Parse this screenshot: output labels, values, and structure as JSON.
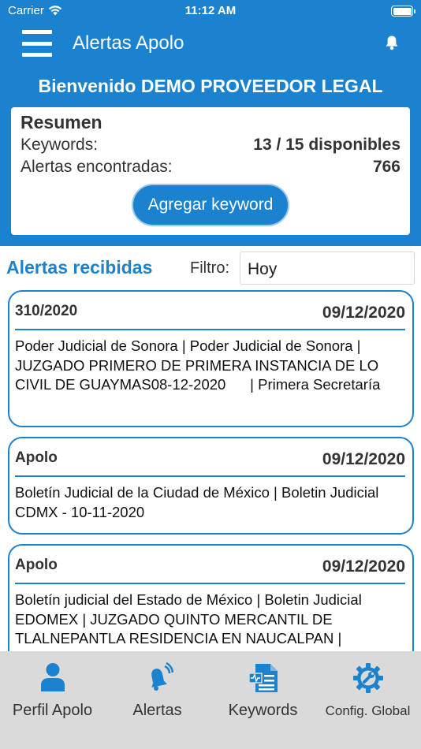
{
  "status_bar": {
    "carrier": "Carrier",
    "time": "11:12 AM"
  },
  "nav": {
    "title": "Alertas Apolo"
  },
  "welcome": {
    "title": "Bienvenido DEMO PROVEEDOR LEGAL"
  },
  "summary": {
    "heading": "Resumen",
    "keywords_label": "Keywords:",
    "keywords_value": "13 / 15 disponibles",
    "alerts_label": "Alertas encontradas:",
    "alerts_value": "766",
    "add_button": "Agregar keyword"
  },
  "alerts": {
    "heading": "Alertas recibidas",
    "filter_label": "Filtro:",
    "filter_value": "Hoy",
    "items": [
      {
        "source": "310/2020",
        "date": "09/12/2020",
        "description": "Poder Judicial de Sonora | Poder Judicial de Sonora | JUZGADO PRIMERO DE PRIMERA INSTANCIA DE LO CIVIL DE GUAYMAS08-12-2020      | Primera Secretaría"
      },
      {
        "source": "Apolo",
        "date": "09/12/2020",
        "description": "Boletín Judicial de la Ciudad de México | Boletin Judicial CDMX - 10-11-2020"
      },
      {
        "source": "Apolo",
        "date": "09/12/2020",
        "description": "Boletín judicial del Estado de México | Boletin Judicial EDOMEX | JUZGADO QUINTO MERCANTIL DE TLALNEPANTLA RESIDENCIA EN NAUCALPAN |"
      }
    ]
  },
  "tabs": [
    {
      "label": "Perfil Apolo",
      "icon": "person-icon"
    },
    {
      "label": "Alertas",
      "icon": "bell-ringing-icon"
    },
    {
      "label": "Keywords",
      "icon": "document-icon"
    },
    {
      "label": "Config. Global",
      "icon": "gear-wrench-icon"
    }
  ],
  "colors": {
    "primary": "#1a82cf",
    "tab_bar": "#dadada",
    "card_border": "#1a82cf"
  }
}
